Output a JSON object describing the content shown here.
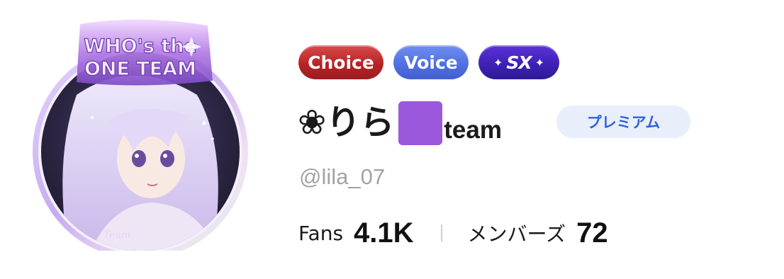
{
  "avatar": {
    "banner_line1": "WHO's the",
    "banner_line2": "ONE TEAM",
    "corner_script": "Team"
  },
  "badges": [
    {
      "label": "Choice",
      "color": "#b82327"
    },
    {
      "label": "Voice",
      "color": "#4f6ee0"
    },
    {
      "label": "SX",
      "color": "#3d1fb2"
    }
  ],
  "profile": {
    "name_icon": "❀",
    "name": "りら",
    "name_emoji": "purple-square",
    "name_suffix": "team",
    "premium_label": "プレミアム",
    "handle": "@lila_07"
  },
  "stats": {
    "fans_label": "Fans",
    "fans_value": "4.1K",
    "members_label": "メンバーズ",
    "members_value": "72"
  },
  "colors": {
    "premium_text": "#2f63d8",
    "premium_bg": "#e9eefb",
    "handle": "#a3a3a3",
    "avatar_frame": "#c9b3ee"
  }
}
